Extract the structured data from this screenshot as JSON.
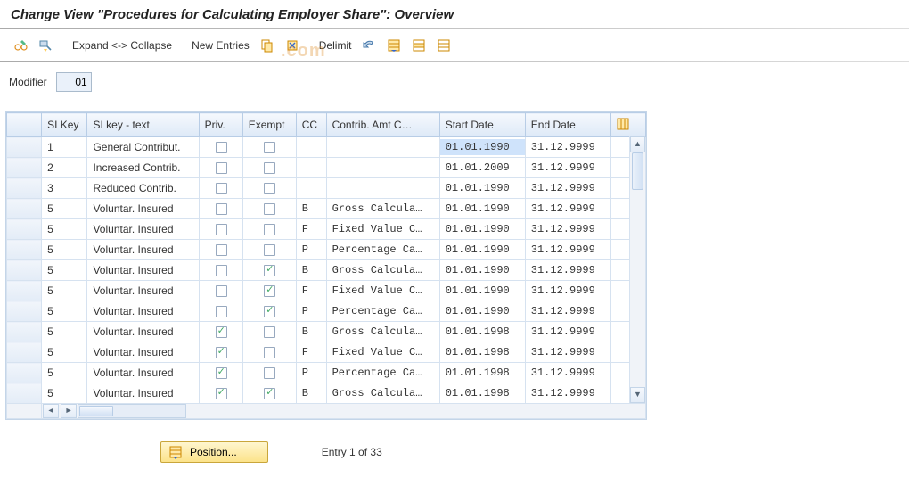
{
  "title": "Change View \"Procedures for Calculating Employer Share\": Overview",
  "watermark": ".com",
  "toolbar": {
    "expand_collapse": "Expand <-> Collapse",
    "new_entries": "New Entries",
    "delimit": "Delimit"
  },
  "modifier": {
    "label": "Modifier",
    "value": "01"
  },
  "columns": {
    "si_key": "SI Key",
    "si_text": "SI key - text",
    "priv": "Priv.",
    "exempt": "Exempt",
    "cc": "CC",
    "contrib": "Contrib. Amt C…",
    "start": "Start Date",
    "end": "End Date"
  },
  "rows": [
    {
      "si": "1",
      "txt": "General Contribut.",
      "priv": false,
      "ex": false,
      "cc": "",
      "amt": "",
      "start": "01.01.1990",
      "end": "31.12.9999",
      "hl": true
    },
    {
      "si": "2",
      "txt": "Increased Contrib.",
      "priv": false,
      "ex": false,
      "cc": "",
      "amt": "",
      "start": "01.01.2009",
      "end": "31.12.9999"
    },
    {
      "si": "3",
      "txt": "Reduced Contrib.",
      "priv": false,
      "ex": false,
      "cc": "",
      "amt": "",
      "start": "01.01.1990",
      "end": "31.12.9999"
    },
    {
      "si": "5",
      "txt": "Voluntar. Insured",
      "priv": false,
      "ex": false,
      "cc": "B",
      "amt": "Gross Calcula…",
      "start": "01.01.1990",
      "end": "31.12.9999"
    },
    {
      "si": "5",
      "txt": "Voluntar. Insured",
      "priv": false,
      "ex": false,
      "cc": "F",
      "amt": "Fixed Value C…",
      "start": "01.01.1990",
      "end": "31.12.9999"
    },
    {
      "si": "5",
      "txt": "Voluntar. Insured",
      "priv": false,
      "ex": false,
      "cc": "P",
      "amt": "Percentage Ca…",
      "start": "01.01.1990",
      "end": "31.12.9999"
    },
    {
      "si": "5",
      "txt": "Voluntar. Insured",
      "priv": false,
      "ex": true,
      "cc": "B",
      "amt": "Gross Calcula…",
      "start": "01.01.1990",
      "end": "31.12.9999"
    },
    {
      "si": "5",
      "txt": "Voluntar. Insured",
      "priv": false,
      "ex": true,
      "cc": "F",
      "amt": "Fixed Value C…",
      "start": "01.01.1990",
      "end": "31.12.9999"
    },
    {
      "si": "5",
      "txt": "Voluntar. Insured",
      "priv": false,
      "ex": true,
      "cc": "P",
      "amt": "Percentage Ca…",
      "start": "01.01.1990",
      "end": "31.12.9999"
    },
    {
      "si": "5",
      "txt": "Voluntar. Insured",
      "priv": true,
      "ex": false,
      "cc": "B",
      "amt": "Gross Calcula…",
      "start": "01.01.1998",
      "end": "31.12.9999"
    },
    {
      "si": "5",
      "txt": "Voluntar. Insured",
      "priv": true,
      "ex": false,
      "cc": "F",
      "amt": "Fixed Value C…",
      "start": "01.01.1998",
      "end": "31.12.9999"
    },
    {
      "si": "5",
      "txt": "Voluntar. Insured",
      "priv": true,
      "ex": false,
      "cc": "P",
      "amt": "Percentage Ca…",
      "start": "01.01.1998",
      "end": "31.12.9999"
    },
    {
      "si": "5",
      "txt": "Voluntar. Insured",
      "priv": true,
      "ex": true,
      "cc": "B",
      "amt": "Gross Calcula…",
      "start": "01.01.1998",
      "end": "31.12.9999"
    }
  ],
  "footer": {
    "position": "Position...",
    "entry": "Entry 1 of 33"
  }
}
